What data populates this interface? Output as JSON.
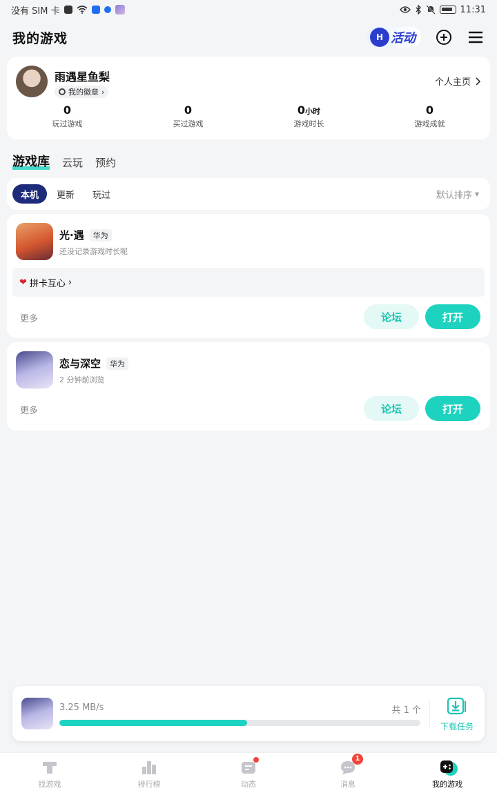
{
  "status_bar": {
    "carrier": "没有 SIM 卡",
    "time": "11:31"
  },
  "header": {
    "title": "我的游戏",
    "activity_label": "活动"
  },
  "profile": {
    "username": "雨遇星鱼梨",
    "badge_label": "我的徽章",
    "homepage_label": "个人主页",
    "stats": [
      {
        "value": "0",
        "unit": "",
        "label": "玩过游戏"
      },
      {
        "value": "0",
        "unit": "",
        "label": "买过游戏"
      },
      {
        "value": "0",
        "unit": "小时",
        "label": "游戏时长"
      },
      {
        "value": "0",
        "unit": "",
        "label": "游戏成就"
      }
    ]
  },
  "library_tabs": [
    {
      "label": "游戏库",
      "active": true
    },
    {
      "label": "云玩",
      "active": false
    },
    {
      "label": "预约",
      "active": false
    }
  ],
  "filters": {
    "chips": [
      {
        "label": "本机",
        "active": true
      },
      {
        "label": "更新",
        "active": false
      },
      {
        "label": "玩过",
        "active": false
      }
    ],
    "sort_label": "默认排序"
  },
  "games": [
    {
      "name": "光·遇",
      "platform": "华为",
      "subtitle": "还没记录游戏时长呢",
      "checkin": "拼卡互心",
      "more_label": "更多",
      "forum_label": "论坛",
      "open_label": "打开"
    },
    {
      "name": "恋与深空",
      "platform": "华为",
      "subtitle": "2 分钟前浏览",
      "more_label": "更多",
      "forum_label": "论坛",
      "open_label": "打开"
    }
  ],
  "download": {
    "speed": "3.25 MB/s",
    "count": "共 1 个",
    "progress": 0.52,
    "task_label": "下载任务"
  },
  "bottom_nav": [
    {
      "label": "找游戏",
      "icon": "find-game-icon",
      "active": false
    },
    {
      "label": "排行榜",
      "icon": "ranking-icon",
      "active": false
    },
    {
      "label": "动态",
      "icon": "feed-icon",
      "active": false
    },
    {
      "label": "消息",
      "icon": "message-icon",
      "active": false,
      "badge": "1"
    },
    {
      "label": "我的游戏",
      "icon": "my-games-icon",
      "active": true
    }
  ],
  "colors": {
    "accent": "#1dd3bf",
    "chip_active": "#1e2b7a",
    "badge_red": "#f0443a"
  }
}
